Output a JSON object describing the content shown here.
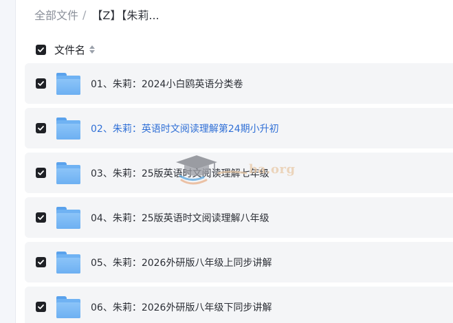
{
  "breadcrumb": {
    "root": "全部文件",
    "separator": "/",
    "current": "【Z】【朱莉..."
  },
  "header": {
    "select_all_checked": true,
    "column_name": "文件名",
    "sort_icon": "sort-updown-icon"
  },
  "rows": [
    {
      "name": "01、朱莉：2024小白鸥英语分类卷",
      "checked": true,
      "icon": "folder-icon"
    },
    {
      "name": "02、朱莉：英语时文阅读理解第24期小升初",
      "checked": true,
      "icon": "folder-icon"
    },
    {
      "name": "03、朱莉：25版英语时文阅读理解七年级",
      "checked": true,
      "icon": "folder-icon"
    },
    {
      "name": "04、朱莉：25版英语时文阅读理解八年级",
      "checked": true,
      "icon": "folder-icon"
    },
    {
      "name": "05、朱莉：2026外研版八年级上同步讲解",
      "checked": true,
      "icon": "folder-icon"
    },
    {
      "name": "06、朱莉：2026外研版八年级下同步讲解",
      "checked": true,
      "icon": "folder-icon"
    }
  ],
  "watermark": {
    "text": "ba.org",
    "icon": "graduation-cap-icon"
  },
  "colors": {
    "link_blue": "#2f6fd6",
    "folder_blue": "#6fb2f3",
    "checkbox_dark": "#1f2126",
    "row_bg": "#f4f5f7"
  }
}
